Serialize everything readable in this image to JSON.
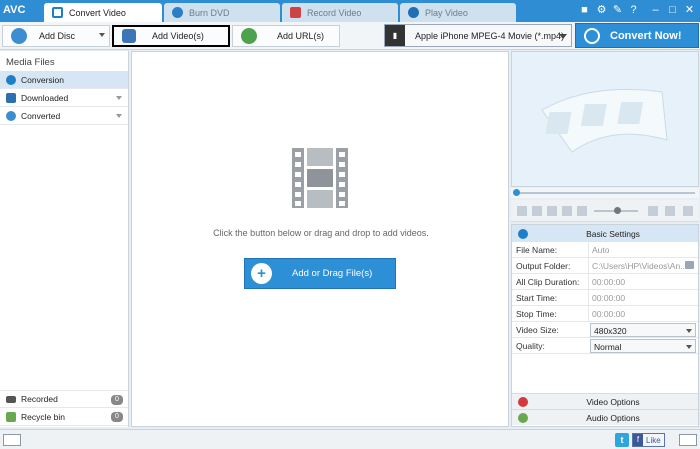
{
  "app": {
    "logo": "AVC"
  },
  "tabs": [
    {
      "label": "Convert Video",
      "active": true,
      "icon": "convert-video-icon"
    },
    {
      "label": "Burn DVD",
      "active": false,
      "icon": "disc-icon"
    },
    {
      "label": "Record Video",
      "active": false,
      "icon": "record-icon"
    },
    {
      "label": "Play Video",
      "active": false,
      "icon": "play-icon"
    }
  ],
  "titlebar_buttons": {
    "account": "■",
    "settings": "⚙",
    "tools": "✎",
    "help": "?",
    "minimize": "–",
    "maximize": "□",
    "close": "✕"
  },
  "toolbar": {
    "add_disc": "Add Disc",
    "add_videos": "Add Video(s)",
    "add_url": "Add URL(s)",
    "output_format": "Apple iPhone MPEG-4 Movie (*.mp4)",
    "convert_now": "Convert Now!"
  },
  "sidebar": {
    "title": "Media Files",
    "items": [
      {
        "label": "Conversion"
      },
      {
        "label": "Downloaded"
      },
      {
        "label": "Converted"
      }
    ],
    "bottom_items": [
      {
        "label": "Recorded",
        "count": "0"
      },
      {
        "label": "Recycle bin",
        "count": "0"
      }
    ]
  },
  "main": {
    "hint": "Click the button below or drag and drop to add videos.",
    "add_button": "Add or Drag File(s)"
  },
  "settings": {
    "title": "Basic Settings",
    "file_name": {
      "label": "File Name:",
      "value": "Auto"
    },
    "output_folder": {
      "label": "Output Folder:",
      "value": "C:\\Users\\HP\\Videos\\An..."
    },
    "all_clip_duration": {
      "label": "All Clip Duration:",
      "value": "00:00:00"
    },
    "start_time": {
      "label": "Start Time:",
      "value": "00:00:00"
    },
    "stop_time": {
      "label": "Stop Time:",
      "value": "00:00:00"
    },
    "video_size": {
      "label": "Video Size:",
      "value": "480x320"
    },
    "quality": {
      "label": "Quality:",
      "value": "Normal"
    },
    "video_options": "Video Options",
    "audio_options": "Audio Options"
  },
  "statusbar": {
    "twitter": "t",
    "facebook_f": "f",
    "facebook_like": "Like"
  },
  "colors": {
    "accent": "#2d8fd6",
    "titlebar": "#2f8ed3",
    "selected_row": "#d7e6f4"
  }
}
